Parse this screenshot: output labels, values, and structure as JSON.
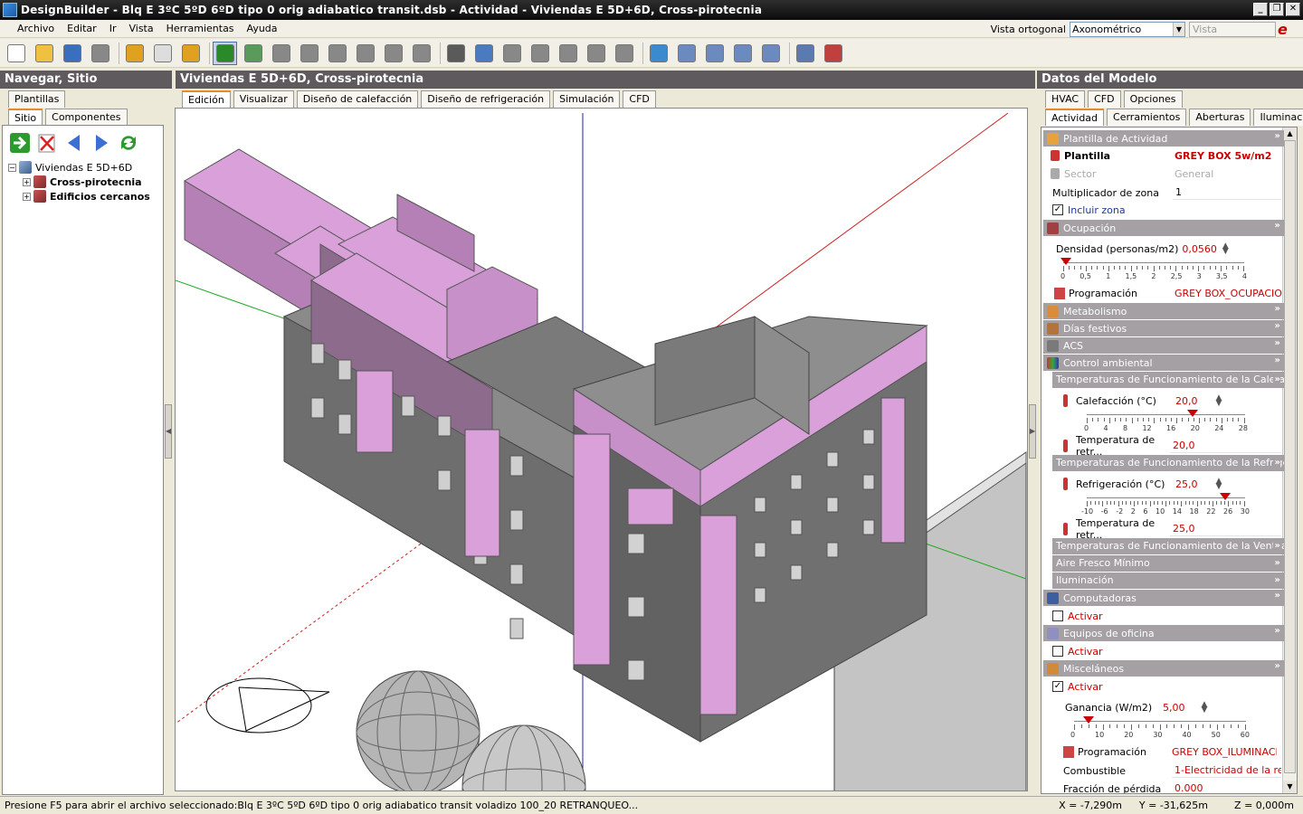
{
  "titlebar": {
    "title": "DesignBuilder - Blq E 3ºC 5ºD 6ºD tipo 0 orig adiabatico transit.dsb - Actividad - Viviendas E 5D+6D, Cross-pirotecnia"
  },
  "menu": [
    "Archivo",
    "Editar",
    "Ir",
    "Vista",
    "Herramientas",
    "Ayuda"
  ],
  "viewcontrols": {
    "label": "Vista ortogonal",
    "combo_value": "Axonométrico",
    "perp_button": "Vista perpendicular"
  },
  "toolbar_icons": [
    "new-file-icon",
    "open-folder-icon",
    "save-icon",
    "print-icon",
    "wrench-icon",
    "eraser-icon",
    "template-icon",
    "select-arrow-icon",
    "add-block-icon",
    "draw-block-icon",
    "partition-icon",
    "component-block-icon",
    "ground-block-icon",
    "move-icon",
    "cut-icon",
    "measure-icon",
    "dimension-icon",
    "move-item-icon",
    "copy-icon",
    "rotate-icon",
    "stretch-icon",
    "mirror-icon",
    "orbit-icon",
    "zoom-in-icon",
    "zoom-window-icon",
    "pan-icon",
    "zoom-extents-icon",
    "check-icon",
    "fix-icon"
  ],
  "left": {
    "header": "Navegar, Sitio",
    "tabs_top": [
      "Plantillas"
    ],
    "tabs": [
      "Sitio",
      "Componentes"
    ],
    "tree": {
      "root": "Viviendas E 5D+6D",
      "children": [
        "Cross-pirotecnia",
        "Edificios cercanos"
      ]
    }
  },
  "center": {
    "header": "Viviendas E 5D+6D, Cross-pirotecnia",
    "tabs": [
      "Edición",
      "Visualizar",
      "Diseño de calefacción",
      "Diseño de refrigeración",
      "Simulación",
      "CFD"
    ]
  },
  "right": {
    "header": "Datos del Modelo",
    "tabs_top": [
      "HVAC",
      "CFD",
      "Opciones"
    ],
    "tabs": [
      "Actividad",
      "Cerramientos",
      "Aberturas",
      "Iluminación"
    ],
    "sections": {
      "plantilla": "Plantilla de Actividad",
      "plantilla_label": "Plantilla",
      "plantilla_value": "GREY BOX 5w/m2",
      "sector_label": "Sector",
      "sector_value": "General",
      "mult_label": "Multiplicador de zona",
      "mult_value": "1",
      "incluir": "Incluir zona",
      "ocupacion": "Ocupación",
      "densidad_label": "Densidad (personas/m2)",
      "densidad_value": "0,0560",
      "densidad_scale": [
        "0",
        "0,5",
        "1",
        "1,5",
        "2",
        "2,5",
        "3",
        "3,5",
        "4"
      ],
      "prog_label": "Programación",
      "prog_value": "GREY BOX_OCUPACIO",
      "metabolismo": "Metabolismo",
      "festivos": "Días festivos",
      "acs": "ACS",
      "control": "Control ambiental",
      "temp_cal": "Temperaturas de Funcionamiento de la Calefacción",
      "cal_label": "Calefacción (°C)",
      "cal_value": "20,0",
      "cal_scale": [
        "0",
        "4",
        "8",
        "12",
        "16",
        "20",
        "24",
        "28"
      ],
      "retr_label": "Temperatura de retr...",
      "retr_cal_value": "20,0",
      "temp_ref": "Temperaturas de Funcionamiento de la Refrigeración",
      "ref_label": "Refrigeración (°C)",
      "ref_value": "25,0",
      "ref_scale": [
        "-10",
        "-6",
        "-2",
        "2",
        "6",
        "10",
        "14",
        "18",
        "22",
        "26",
        "30"
      ],
      "retr_ref_value": "25,0",
      "temp_vent": "Temperaturas de Funcionamiento de la Ventilación",
      "aire": "Aire Fresco Mínimo",
      "ilum": "Iluminación",
      "comput": "Computadoras",
      "activar": "Activar",
      "equipos": "Equipos de oficina",
      "misc": "Misceláneos",
      "ganancia_label": "Ganancia (W/m2)",
      "ganancia_value": "5,00",
      "gan_scale": [
        "0",
        "10",
        "20",
        "30",
        "40",
        "50",
        "60"
      ],
      "prog2_value": "GREY BOX_ILUMINACI",
      "comb_label": "Combustible",
      "comb_value": "1-Electricidad de la re",
      "frac_label": "Fracción de pérdida",
      "frac_value": "0.000"
    },
    "sliders": {
      "densidad_level": 0.014,
      "cal_level": 0.667,
      "ref_level": 0.875,
      "gan_level": 0.083
    }
  },
  "status": {
    "message": "Presione F5 para abrir el archivo seleccionado:Blq E 3ºC 5ºD 6ºD tipo 0 orig adiabatico transit voladizo 100_20 RETRANQUEO...",
    "x": "X = -7,290m",
    "y": "Y = -31,625m",
    "z": "Z = 0,000m"
  },
  "colors": {
    "pink": "#d9a0d9",
    "grey": "#6e6e6e",
    "header_bg": "#5f5a5e",
    "section_bg": "#a4a0a4"
  }
}
